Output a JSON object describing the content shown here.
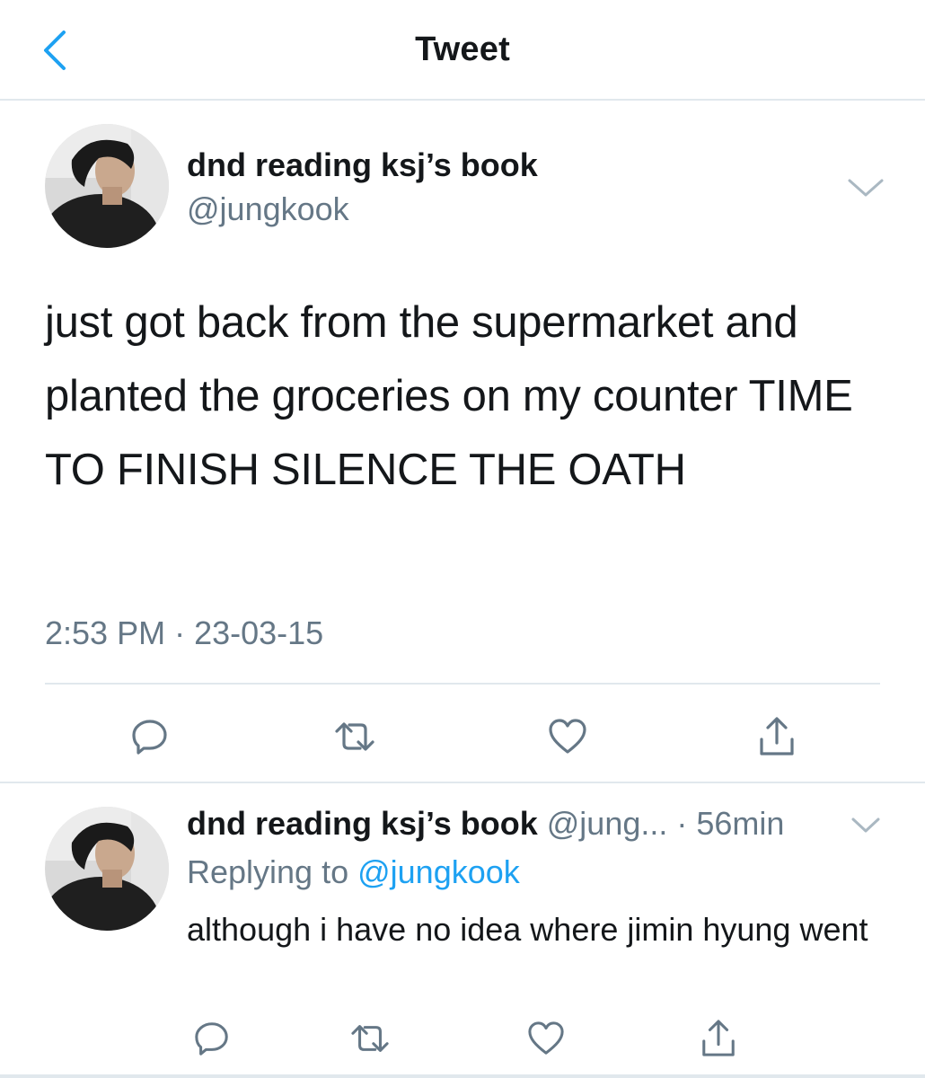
{
  "header": {
    "title": "Tweet",
    "back_icon": "chevron-left-icon",
    "accent_color": "#1da1f2"
  },
  "main_tweet": {
    "display_name": "dnd reading ksj’s book",
    "handle": "@jungkook",
    "text": "just got back from the supermarket and planted the groceries on my counter TIME TO FINISH SILENCE THE OATH",
    "time": "2:53 PM",
    "separator": " · ",
    "date": "23-03-15",
    "actions": [
      "reply-icon",
      "retweet-icon",
      "like-icon",
      "share-icon"
    ]
  },
  "reply_tweet": {
    "display_name": "dnd reading ksj’s book",
    "handle": "@jung...",
    "dot": " · ",
    "time": "56min",
    "replying_prefix": "Replying to ",
    "replying_handle": "@jungkook",
    "text": "although i have no idea where jimin hyung went",
    "actions": [
      "reply-icon",
      "retweet-icon",
      "like-icon",
      "share-icon"
    ]
  }
}
